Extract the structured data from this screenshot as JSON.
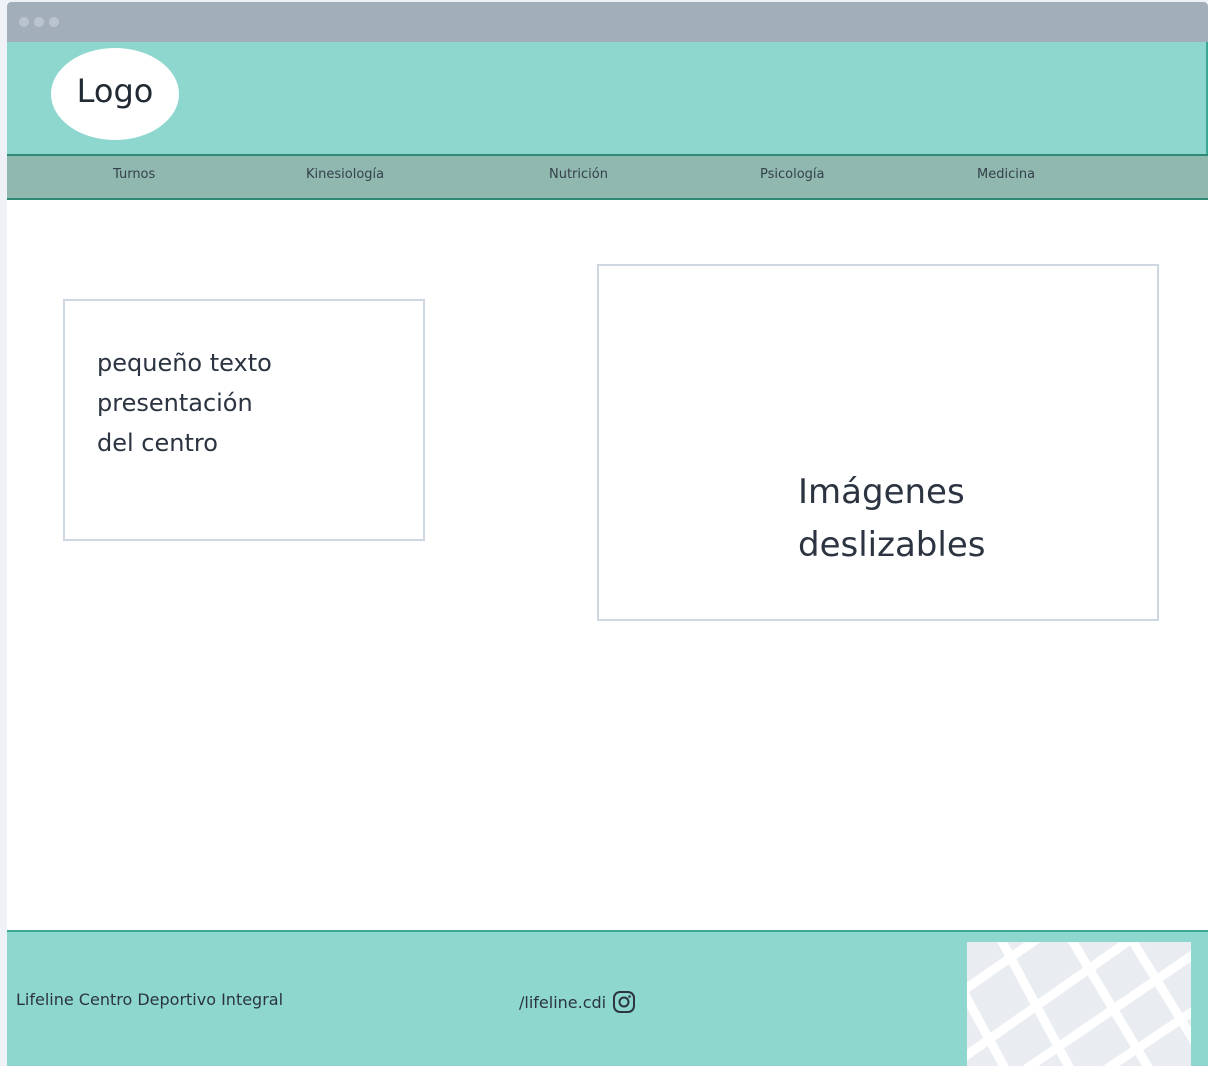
{
  "header": {
    "logo_text": "Logo"
  },
  "nav": {
    "items": [
      {
        "label": "Turnos"
      },
      {
        "label": "Kinesiología"
      },
      {
        "label": "Nutrición"
      },
      {
        "label": "Psicología"
      },
      {
        "label": "Medicina"
      }
    ]
  },
  "main": {
    "intro_text": "pequeño texto\npresentación\ndel centro",
    "slider_text": "Imágenes\ndeslizables"
  },
  "footer": {
    "name": "Lifeline Centro Deportivo Integral",
    "instagram_handle": "/lifeline.cdi",
    "icons": [
      "instagram-icon"
    ]
  },
  "colors": {
    "header_bg": "#8dd7cf",
    "nav_bg": "#91b8ae",
    "accent_border": "#2d8a75",
    "titlebar": "#a2afbb"
  }
}
